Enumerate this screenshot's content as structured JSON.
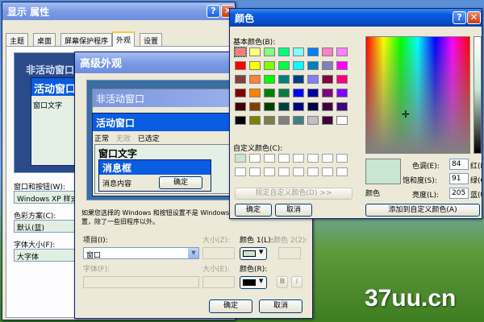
{
  "display_props": {
    "title": "显示 属性",
    "tabs": [
      "主题",
      "桌面",
      "屏幕保护程序",
      "外观",
      "设置"
    ],
    "active_tab": "外观",
    "preview_inactive_title": "非活动窗口",
    "preview_active_title": "活动窗口",
    "preview_window_text": "窗口文字",
    "windows_buttons_label": "窗口和按钮(W):",
    "windows_buttons_value": "Windows XP 样式",
    "color_scheme_label": "色彩方案(C):",
    "color_scheme_value": "默认(蓝)",
    "font_size_label": "字体大小(F):",
    "font_size_value": "大字体"
  },
  "advanced": {
    "title": "高级外观",
    "inactive_window": "非活动窗口",
    "active_window": "活动窗口",
    "menu_normal": "正常",
    "menu_disabled": "无效",
    "menu_selected": "已选定",
    "window_text": "窗口文字",
    "message_box": "消息框",
    "message_text": "消息内容",
    "ok_preview": "确定",
    "note": "如果您选择的 Windows 和按钮设置不是 Windows 经典，它将替代下列设置，除了一些旧程序以外。",
    "item_label": "项目(I):",
    "item_value": "窗口",
    "size_label": "大小(Z):",
    "color1_label": "颜色 1(L):",
    "color2_label": "颜色 2(2):",
    "font_label": "字体(F):",
    "font_size_label": "大小(E):",
    "font_color_label": "颜色(R):",
    "color1_value": "#c8e6d2",
    "font_color_value": "#000000",
    "bold_label": "B",
    "italic_label": "I",
    "ok": "确定",
    "cancel": "取消"
  },
  "color_dialog": {
    "title": "颜色",
    "basic_label": "基本颜色(B):",
    "custom_label": "自定义颜色(C):",
    "define_button": "规定自定义颜色(D) >>",
    "ok": "确定",
    "cancel": "取消",
    "color_solid_label": "颜色",
    "hue_label": "色调(E):",
    "hue": "84",
    "sat_label": "饱和度(S):",
    "sat": "91",
    "lum_label": "亮度(L):",
    "lum": "205",
    "red_label": "红(R)",
    "green_label": "绿(G)",
    "blue_label": "蓝(U)",
    "add_button": "添加到自定义颜色(A)",
    "selected_color": "#c8e6d2",
    "basic_colors": [
      "#ff8080",
      "#ffff80",
      "#80ff80",
      "#00ff80",
      "#80ffff",
      "#0080ff",
      "#ff80c0",
      "#ff80ff",
      "#ff0000",
      "#ffff00",
      "#80ff00",
      "#00ff40",
      "#00ffff",
      "#0080c0",
      "#8080c0",
      "#ff00ff",
      "#804040",
      "#ff8040",
      "#00ff00",
      "#008080",
      "#004080",
      "#8080ff",
      "#800040",
      "#ff0080",
      "#800000",
      "#ff8000",
      "#008000",
      "#008040",
      "#0000ff",
      "#0000a0",
      "#800080",
      "#8000ff",
      "#400000",
      "#804000",
      "#004000",
      "#004040",
      "#000080",
      "#000040",
      "#400040",
      "#400080",
      "#000000",
      "#808000",
      "#808040",
      "#808080",
      "#408080",
      "#c0c0c0",
      "#400040",
      "#ffffff"
    ]
  },
  "watermark": "37uu.cn"
}
